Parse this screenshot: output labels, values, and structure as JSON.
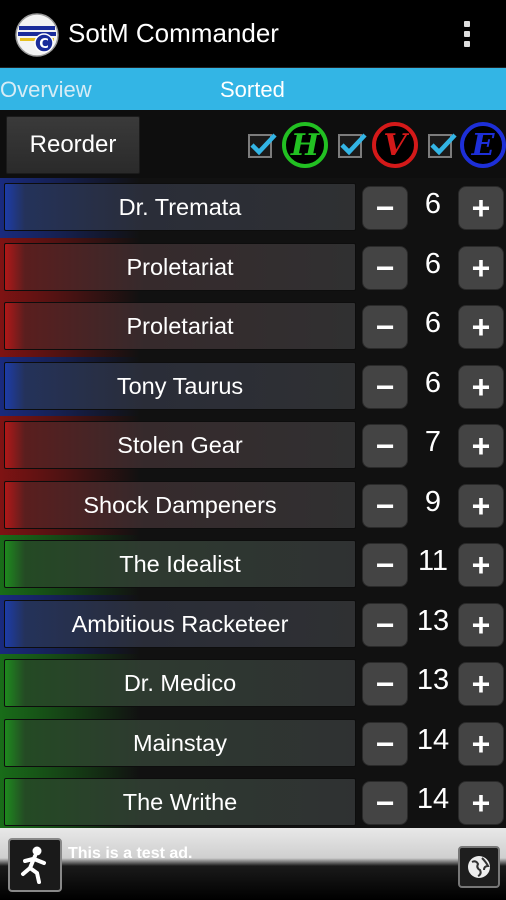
{
  "app": {
    "title": "SotM Commander",
    "icon": "sotm-logo-icon"
  },
  "tabs": {
    "overview": "Overview",
    "sorted": "Sorted",
    "active": "Sorted"
  },
  "filters": {
    "reorder_label": "Reorder",
    "badges": [
      {
        "letter": "H",
        "color": "#22c022",
        "checked": true
      },
      {
        "letter": "V",
        "color": "#d41919",
        "checked": true
      },
      {
        "letter": "E",
        "color": "#1d2fd8",
        "checked": true
      }
    ]
  },
  "colors": {
    "accent": "#33b5e5",
    "hero": "#22c022",
    "villain": "#d41919",
    "environment": "#1d2fd8"
  },
  "rows": [
    {
      "name": "Dr. Tremata",
      "count": "6",
      "team": "blue"
    },
    {
      "name": "Proletariat",
      "count": "6",
      "team": "red"
    },
    {
      "name": "Proletariat",
      "count": "6",
      "team": "red"
    },
    {
      "name": "Tony Taurus",
      "count": "6",
      "team": "blue"
    },
    {
      "name": "Stolen Gear",
      "count": "7",
      "team": "red"
    },
    {
      "name": "Shock Dampeners",
      "count": "9",
      "team": "red"
    },
    {
      "name": "The Idealist",
      "count": "11",
      "team": "green"
    },
    {
      "name": "Ambitious Racketeer",
      "count": "13",
      "team": "blue"
    },
    {
      "name": "Dr. Medico",
      "count": "13",
      "team": "green"
    },
    {
      "name": "Mainstay",
      "count": "14",
      "team": "green"
    },
    {
      "name": "The Writhe",
      "count": "14",
      "team": "green"
    }
  ],
  "ad": {
    "text": "This is a test ad.",
    "icon": "running-man-icon",
    "globe_icon": "globe-icon"
  }
}
